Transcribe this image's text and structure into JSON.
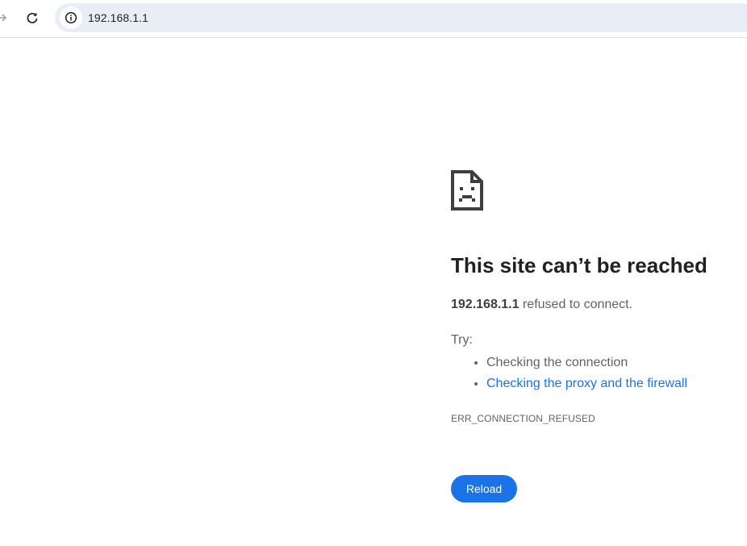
{
  "browser": {
    "url": "192.168.1.1",
    "icons": {
      "forward": "forward-arrow-icon",
      "reload": "reload-icon",
      "site_info": "info-icon"
    }
  },
  "error_page": {
    "icon": "sad-page-icon",
    "title": "This site can’t be reached",
    "host": "192.168.1.1",
    "summary_suffix": " refused to connect.",
    "try_label": "Try:",
    "suggestions": [
      "Checking the connection",
      "Checking the proxy and the firewall"
    ],
    "error_code": "ERR_CONNECTION_REFUSED",
    "reload_label": "Reload"
  },
  "colors": {
    "link": "#1a73e8",
    "button": "#1b73e8",
    "omnibox_bg": "#e9eef6",
    "text": "#202124",
    "secondary_text": "#5f6368"
  }
}
